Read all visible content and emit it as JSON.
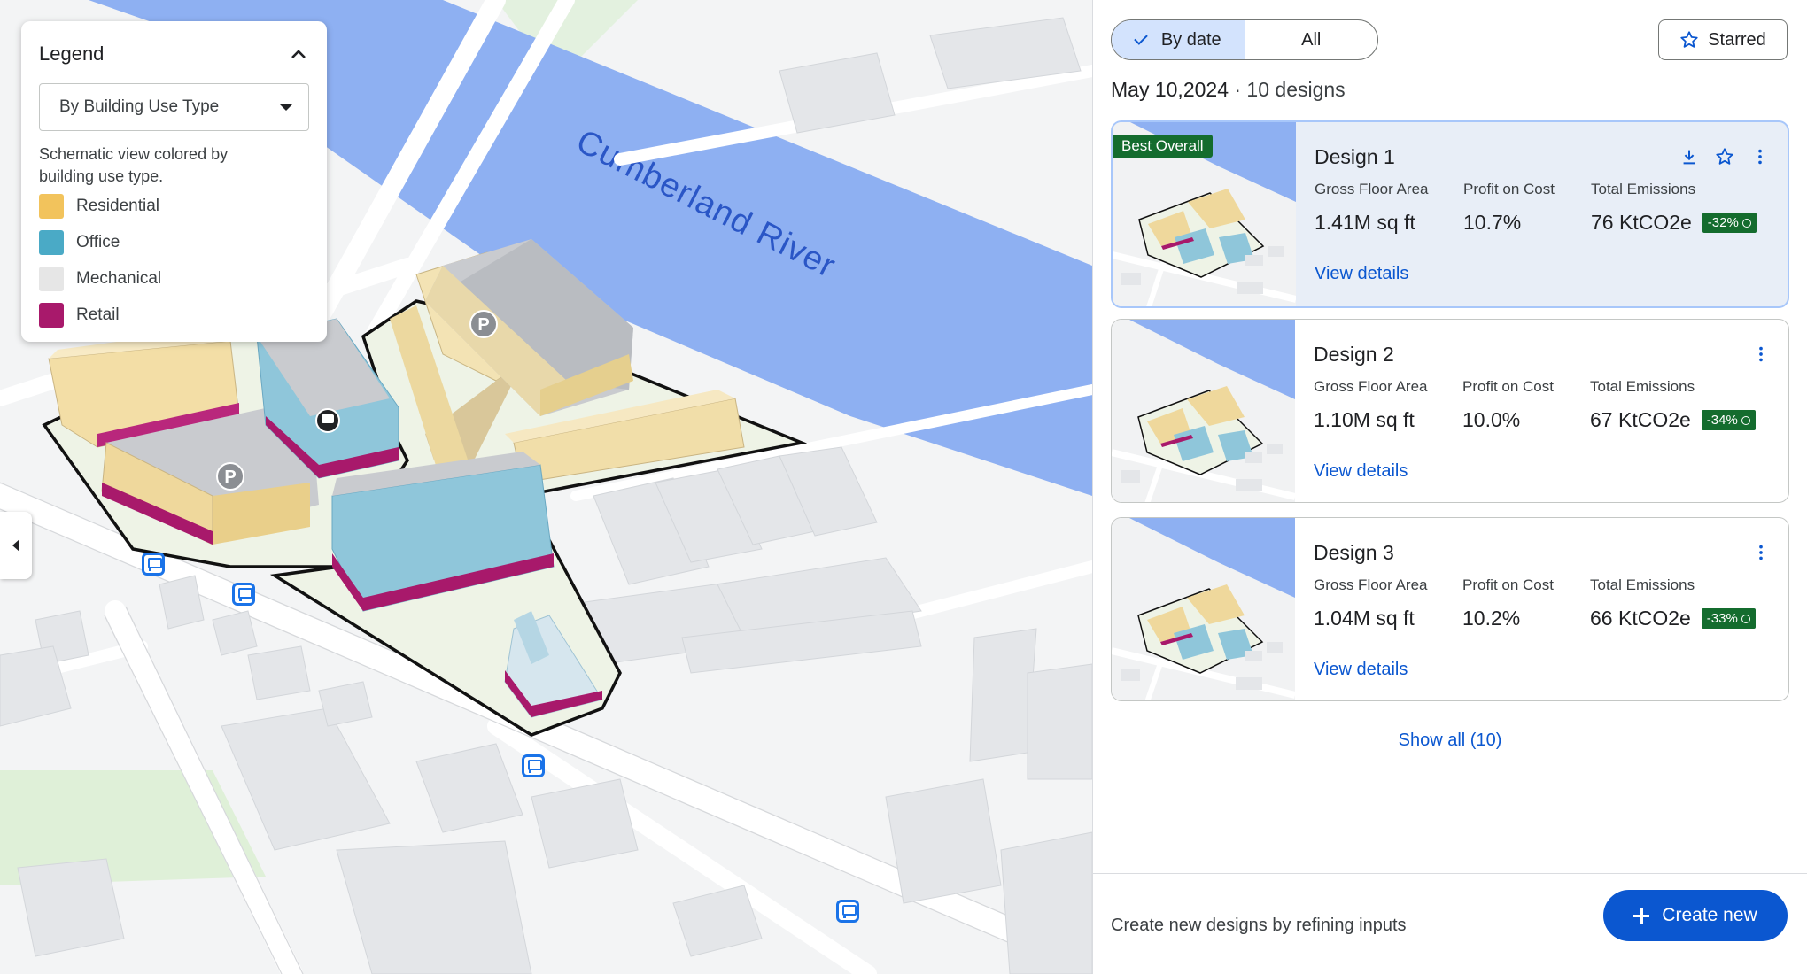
{
  "map": {
    "river_label": "Cumberland River",
    "parking_label": "P"
  },
  "legend": {
    "title": "Legend",
    "selected_view": "By Building Use Type",
    "description": "Schematic view colored by building use type.",
    "items": [
      {
        "label": "Residential",
        "color": "#f2c35c"
      },
      {
        "label": "Office",
        "color": "#4aaac6"
      },
      {
        "label": "Mechanical",
        "color": "#e6e6e6"
      },
      {
        "label": "Retail",
        "color": "#a8196b"
      }
    ]
  },
  "panel": {
    "filter": {
      "by_date": "By date",
      "all": "All"
    },
    "starred": "Starred",
    "date": "May 10,2024",
    "count": " · 10 designs",
    "metric_labels": {
      "gfa": "Gross Floor Area",
      "poc": "Profit on Cost",
      "em": "Total Emissions"
    },
    "view_details": "View details",
    "designs": [
      {
        "badge": "Best Overall",
        "name": "Design 1",
        "gfa": "1.41M sq ft",
        "poc": "10.7%",
        "emissions": "76 KtCO2e",
        "delta": "-32%"
      },
      {
        "name": "Design 2",
        "gfa": "1.10M sq ft",
        "poc": "10.0%",
        "emissions": "67 KtCO2e",
        "delta": "-34%"
      },
      {
        "name": "Design 3",
        "gfa": "1.04M sq ft",
        "poc": "10.2%",
        "emissions": "66 KtCO2e",
        "delta": "-33%"
      }
    ],
    "show_all": "Show all (10)",
    "footer_text": "Create new designs by refining inputs",
    "create_button": "Create new"
  },
  "colors": {
    "accent": "#0b57d0",
    "river": "#8eb0f2",
    "badge_green": "#146c2e"
  }
}
